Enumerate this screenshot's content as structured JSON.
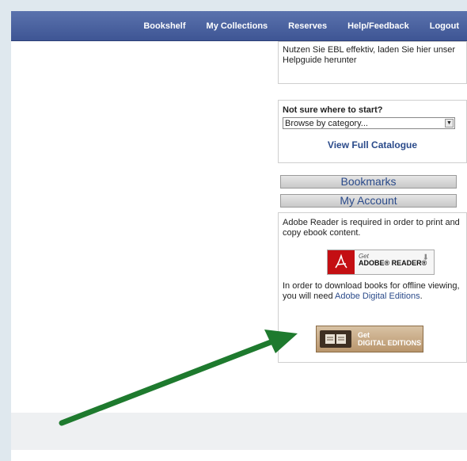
{
  "nav": {
    "bookshelf": "Bookshelf",
    "my_collections": "My Collections",
    "reserves": "Reserves",
    "help_feedback": "Help/Feedback",
    "logout": "Logout"
  },
  "helpguide": {
    "text": "Nutzen Sie EBL effektiv, laden Sie hier unser Helpguide herunter"
  },
  "start": {
    "question": "Not sure where to start?",
    "select_value": "Browse by category...",
    "view_catalogue": "View Full Catalogue"
  },
  "buttons": {
    "bookmarks": "Bookmarks",
    "my_account": "My Account"
  },
  "info": {
    "adobe_text": "Adobe Reader is required in order to print and copy ebook content.",
    "adobe_get": "Get",
    "adobe_name": "ADOBE® READER®",
    "download_text_pre": "In order to download books for offline viewing, you will need ",
    "download_link": "Adobe Digital Editions",
    "download_text_post": ".",
    "de_get": "Get",
    "de_name": "DIGITAL EDITIONS"
  },
  "colors": {
    "nav_bar": "#4a62a1",
    "link": "#2a4a8a",
    "annotation_arrow": "#1e7a2e",
    "adobe_red": "#c40f13"
  }
}
